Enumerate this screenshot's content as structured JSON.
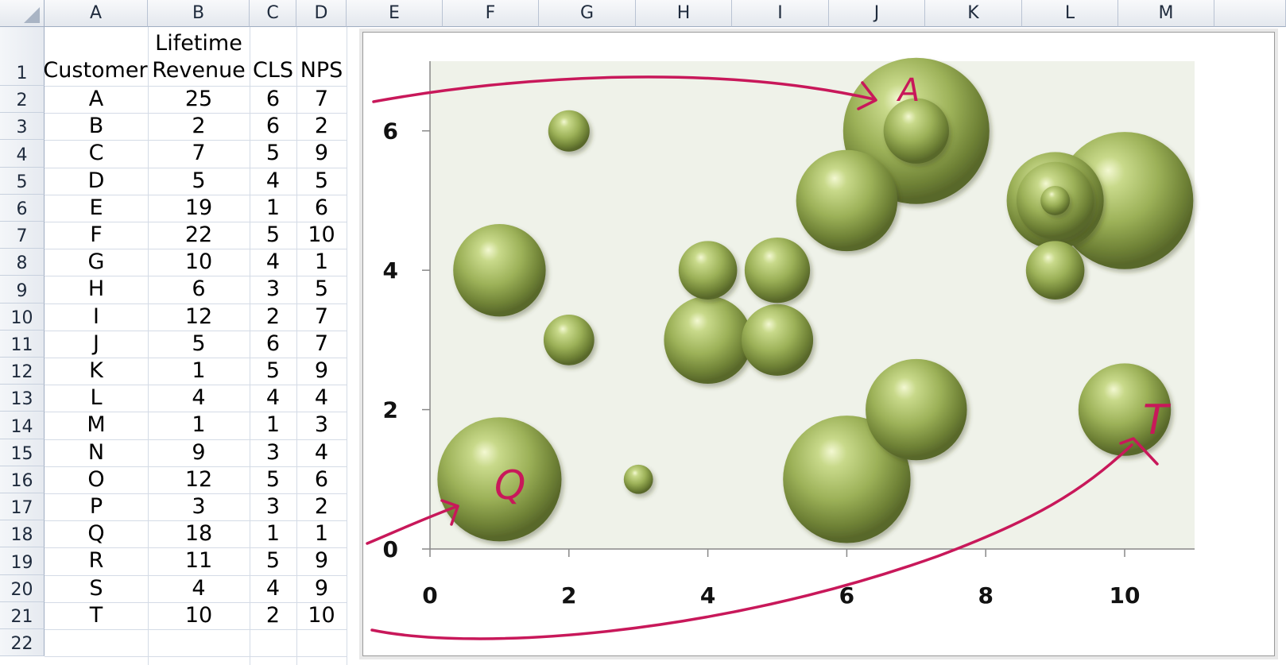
{
  "sheet": {
    "column_headers": [
      "A",
      "B",
      "C",
      "D",
      "E",
      "F",
      "G",
      "H",
      "I",
      "J",
      "K",
      "L",
      "M"
    ],
    "row_headers": [
      "1",
      "2",
      "3",
      "4",
      "5",
      "6",
      "7",
      "8",
      "9",
      "10",
      "11",
      "12",
      "13",
      "14",
      "15",
      "16",
      "17",
      "18",
      "19",
      "20",
      "21",
      "22"
    ],
    "table_headers": {
      "customer": "Customer",
      "lifetime_revenue_line1": "Lifetime",
      "lifetime_revenue_line2": "Revenue",
      "cls": "CLS",
      "nps": "NPS"
    },
    "rows": [
      {
        "customer": "A",
        "revenue": "25",
        "cls": "6",
        "nps": "7"
      },
      {
        "customer": "B",
        "revenue": "2",
        "cls": "6",
        "nps": "2"
      },
      {
        "customer": "C",
        "revenue": "7",
        "cls": "5",
        "nps": "9"
      },
      {
        "customer": "D",
        "revenue": "5",
        "cls": "4",
        "nps": "5"
      },
      {
        "customer": "E",
        "revenue": "19",
        "cls": "1",
        "nps": "6"
      },
      {
        "customer": "F",
        "revenue": "22",
        "cls": "5",
        "nps": "10"
      },
      {
        "customer": "G",
        "revenue": "10",
        "cls": "4",
        "nps": "1"
      },
      {
        "customer": "H",
        "revenue": "6",
        "cls": "3",
        "nps": "5"
      },
      {
        "customer": "I",
        "revenue": "12",
        "cls": "2",
        "nps": "7"
      },
      {
        "customer": "J",
        "revenue": "5",
        "cls": "6",
        "nps": "7"
      },
      {
        "customer": "K",
        "revenue": "1",
        "cls": "5",
        "nps": "9"
      },
      {
        "customer": "L",
        "revenue": "4",
        "cls": "4",
        "nps": "4"
      },
      {
        "customer": "M",
        "revenue": "1",
        "cls": "1",
        "nps": "3"
      },
      {
        "customer": "N",
        "revenue": "9",
        "cls": "3",
        "nps": "4"
      },
      {
        "customer": "O",
        "revenue": "12",
        "cls": "5",
        "nps": "6"
      },
      {
        "customer": "P",
        "revenue": "3",
        "cls": "3",
        "nps": "2"
      },
      {
        "customer": "Q",
        "revenue": "18",
        "cls": "1",
        "nps": "1"
      },
      {
        "customer": "R",
        "revenue": "11",
        "cls": "5",
        "nps": "9"
      },
      {
        "customer": "S",
        "revenue": "4",
        "cls": "4",
        "nps": "9"
      },
      {
        "customer": "T",
        "revenue": "10",
        "cls": "2",
        "nps": "10"
      }
    ]
  },
  "annotations": {
    "label_a": "A",
    "label_q": "Q",
    "label_t": "T",
    "color": "#c8185a"
  },
  "chart_data": {
    "type": "bubble",
    "title": "",
    "xlabel": "",
    "ylabel": "",
    "xlim": [
      0,
      11
    ],
    "ylim": [
      0,
      7
    ],
    "x_ticks": [
      0,
      2,
      4,
      6,
      8,
      10
    ],
    "y_ticks": [
      0,
      2,
      4,
      6
    ],
    "grid": false,
    "bubble_color": "#9fb45a",
    "plot_background": "#eff2e9",
    "series": [
      {
        "x_field": "NPS",
        "y_field": "CLS",
        "size_field": "Lifetime Revenue",
        "points": [
          {
            "label": "A",
            "x": 7,
            "y": 6,
            "size": 25
          },
          {
            "label": "B",
            "x": 2,
            "y": 6,
            "size": 2
          },
          {
            "label": "C",
            "x": 9,
            "y": 5,
            "size": 7
          },
          {
            "label": "D",
            "x": 5,
            "y": 4,
            "size": 5
          },
          {
            "label": "E",
            "x": 6,
            "y": 1,
            "size": 19
          },
          {
            "label": "F",
            "x": 10,
            "y": 5,
            "size": 22
          },
          {
            "label": "G",
            "x": 1,
            "y": 4,
            "size": 10
          },
          {
            "label": "H",
            "x": 5,
            "y": 3,
            "size": 6
          },
          {
            "label": "I",
            "x": 7,
            "y": 2,
            "size": 12
          },
          {
            "label": "J",
            "x": 7,
            "y": 6,
            "size": 5
          },
          {
            "label": "K",
            "x": 9,
            "y": 5,
            "size": 1
          },
          {
            "label": "L",
            "x": 4,
            "y": 4,
            "size": 4
          },
          {
            "label": "M",
            "x": 3,
            "y": 1,
            "size": 1
          },
          {
            "label": "N",
            "x": 4,
            "y": 3,
            "size": 9
          },
          {
            "label": "O",
            "x": 6,
            "y": 5,
            "size": 12
          },
          {
            "label": "P",
            "x": 2,
            "y": 3,
            "size": 3
          },
          {
            "label": "Q",
            "x": 1,
            "y": 1,
            "size": 18
          },
          {
            "label": "R",
            "x": 9,
            "y": 5,
            "size": 11
          },
          {
            "label": "S",
            "x": 9,
            "y": 4,
            "size": 4
          },
          {
            "label": "T",
            "x": 10,
            "y": 2,
            "size": 10
          }
        ]
      }
    ]
  }
}
